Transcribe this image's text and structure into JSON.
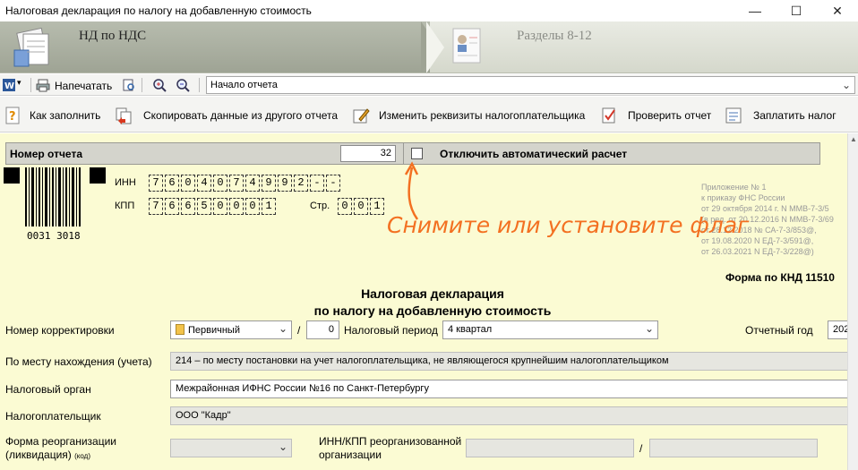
{
  "window": {
    "title": "Налоговая декларация по налогу на добавленную стоимость",
    "min": "—",
    "max": "☐",
    "close": "✕"
  },
  "steps": {
    "step1": "НД по НДС",
    "step2": "Разделы 8-12"
  },
  "toolbar1": {
    "print": "Напечатать",
    "section_combo": "Начало отчета"
  },
  "toolbar2": {
    "how_to_fill": "Как заполнить",
    "copy_data": "Скопировать данные из другого отчета",
    "change_requisites": "Изменить реквизиты налогоплательщика",
    "check_report": "Проверить отчет",
    "pay_tax": "Заплатить налог"
  },
  "report_number": {
    "label": "Номер отчета",
    "value": "32",
    "auto_calc_label": "Отключить автоматический расчет"
  },
  "barcode": {
    "number": "0031 3018"
  },
  "ids": {
    "inn_label": "ИНН",
    "inn_cells": [
      "7",
      "6",
      "0",
      "4",
      "0",
      "7",
      "4",
      "9",
      "9",
      "2",
      "-",
      "-"
    ],
    "kpp_label": "КПП",
    "kpp_cells": [
      "7",
      "6",
      "6",
      "5",
      "0",
      "0",
      "0",
      "1"
    ],
    "page_label": "Стр.",
    "page_cells": [
      "0",
      "0",
      "1"
    ]
  },
  "appendix": {
    "lines": [
      "Приложение № 1",
      "к приказу ФНС России",
      "от 29 октября 2014 г. N ММВ-7-3/5",
      "(в ред. от 20.12.2016 N ММВ-7-3/69",
      "от 28.12.2018 № СА-7-3/853@,",
      "от 19.08.2020 N ЕД-7-3/591@,",
      "от 26.03.2021 N ЕД-7-3/228@)"
    ],
    "form_knd": "Форма по КНД 11510"
  },
  "hint": "Снимите или установите флаг",
  "document": {
    "title1": "Налоговая декларация",
    "title2": "по налогу на добавленную стоимость"
  },
  "form": {
    "correction_label": "Номер корректировки",
    "correction_value": "Первичный",
    "correction_num": "0",
    "slash": "/",
    "period_label": "Налоговый период",
    "period_value": "4 квартал",
    "year_label": "Отчетный год",
    "year_value": "202",
    "location_label": "По месту нахождения (учета)",
    "location_value": "214 – по месту постановки на учет налогоплательщика, не являющегося крупнейшим налогоплательщиком",
    "tax_authority_label": "Налоговый орган",
    "tax_authority_value": "Межрайонная ИФНС России №16 по Санкт-Петербургу",
    "taxpayer_label": "Налогоплательщик",
    "taxpayer_value": "ООО \"Кадр\"",
    "reorg_label_line1": "Форма реорганизации",
    "reorg_label_line2": "(ликвидация)",
    "reorg_label_code": "(код)",
    "reorg_inn_label_line1": "ИНН/КПП реорганизованной",
    "reorg_inn_label_line2": "организации",
    "reorg_slash": "/"
  }
}
